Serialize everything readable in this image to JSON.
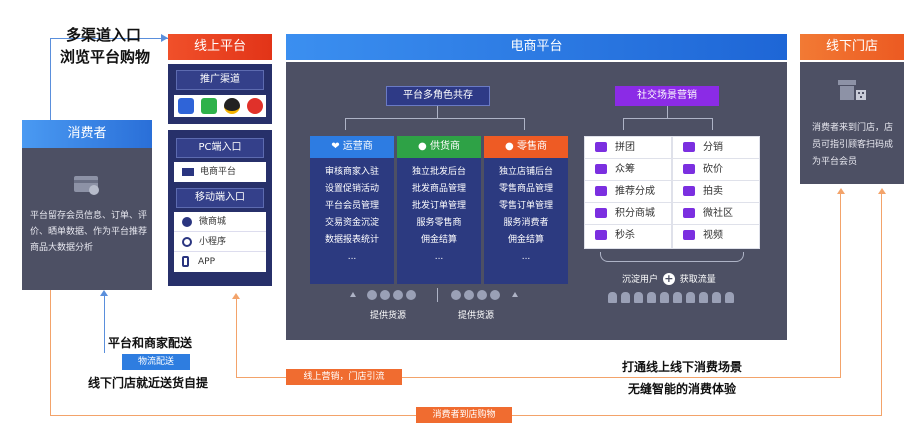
{
  "top_left": {
    "line1": "多渠道入口",
    "line2": "浏览平台购物"
  },
  "consumer": {
    "title": "消费者",
    "description": "平台留存会员信息、订单、评价、晒单数据、作为平台推荐商品大数据分析"
  },
  "online": {
    "title": "线上平台",
    "promo_title": "推广渠道",
    "pc_title": "PC端入口",
    "pc_item": "电商平台",
    "mobile_title": "移动端入口",
    "mobile_items": [
      "微商城",
      "小程序",
      "APP"
    ]
  },
  "ecommerce": {
    "title": "电商平台",
    "multi_role": "平台多角色共存",
    "social": "社交场景营销",
    "columns": [
      {
        "title": "运营商",
        "items": [
          "审核商家入驻",
          "设置促销活动",
          "平台会员管理",
          "交易资金沉淀",
          "数据报表统计",
          "..."
        ]
      },
      {
        "title": "供货商",
        "items": [
          "独立批发后台",
          "批发商品管理",
          "批发订单管理",
          "服务零售商",
          "佣金结算",
          "..."
        ]
      },
      {
        "title": "零售商",
        "items": [
          "独立店铺后台",
          "零售商品管理",
          "零售订单管理",
          "服务消费者",
          "佣金结算",
          "..."
        ]
      }
    ],
    "supply_labels": [
      "提供货源",
      "提供货源"
    ],
    "marketing": [
      "拼团",
      "分销",
      "众筹",
      "砍价",
      "推荐分成",
      "拍卖",
      "积分商城",
      "微社区",
      "秒杀",
      "视频"
    ],
    "retain": "沉淀用户",
    "acquire": "获取流量"
  },
  "offline": {
    "title": "线下门店",
    "description": "消费者来到门店，店员可指引顾客扫码成为平台会员"
  },
  "bottom": {
    "delivery_title": "平台和商家配送",
    "logistics_tag": "物流配送",
    "pickup": "线下门店就近送货自提",
    "online_marketing_tag": "线上营销，门店引流",
    "omni_line1": "打通线上线下消费场景",
    "omni_line2": "无缝智能的消费体验",
    "to_store_tag": "消费者到店购物"
  },
  "colors": {
    "blue_header": "#2a76e6",
    "red_header": "#e8391c",
    "dark_panel": "#4d5064",
    "navy": "#27306a",
    "purple": "#8a2be2",
    "green": "#2fa14a",
    "orange": "#ee5b24"
  }
}
